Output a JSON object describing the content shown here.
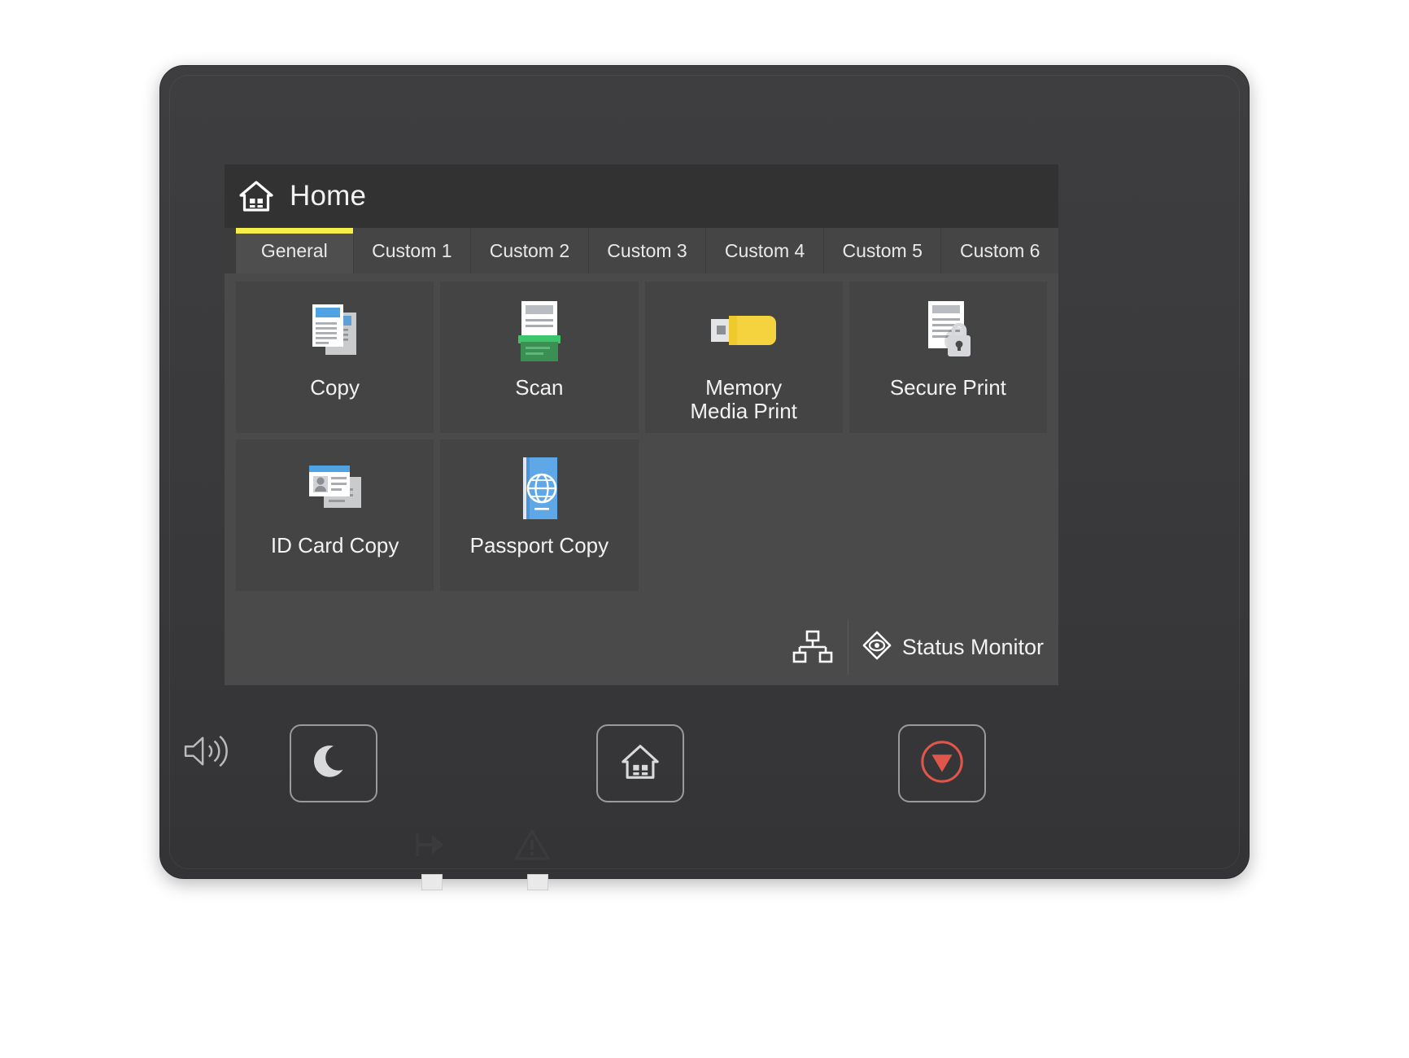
{
  "screen": {
    "header": {
      "title": "Home",
      "icon": "home-house-icon"
    },
    "tabs": [
      {
        "label": "General",
        "active": true
      },
      {
        "label": "Custom 1",
        "active": false
      },
      {
        "label": "Custom 2",
        "active": false
      },
      {
        "label": "Custom 3",
        "active": false
      },
      {
        "label": "Custom 4",
        "active": false
      },
      {
        "label": "Custom 5",
        "active": false
      },
      {
        "label": "Custom 6",
        "active": false
      }
    ],
    "tiles": [
      {
        "label": "Copy",
        "icon": "copy-documents-icon"
      },
      {
        "label": "Scan",
        "icon": "scan-tray-icon"
      },
      {
        "label": "Memory\nMedia Print",
        "icon": "usb-drive-icon"
      },
      {
        "label": "Secure Print",
        "icon": "document-lock-icon"
      },
      {
        "label": "ID Card Copy",
        "icon": "id-card-icon"
      },
      {
        "label": "Passport Copy",
        "icon": "passport-globe-icon"
      }
    ],
    "status_bar": {
      "network_icon": "network-sitemap-icon",
      "status_monitor_icon": "status-monitor-eye-icon",
      "status_monitor_label": "Status Monitor"
    }
  },
  "hardware": {
    "speaker_icon": "speaker-volume-icon",
    "keys": [
      {
        "name": "sleep",
        "icon": "moon-sleep-icon"
      },
      {
        "name": "home",
        "icon": "home-house-icon"
      },
      {
        "name": "stop",
        "icon": "stop-octagon-icon"
      }
    ],
    "lamps": [
      {
        "name": "data",
        "icon": "data-arrow-icon"
      },
      {
        "name": "error",
        "icon": "warning-triangle-icon"
      }
    ]
  },
  "colors": {
    "accent_yellow": "#f6ef4a",
    "screen_bg": "#3c3c3c",
    "tile_bg": "#444444",
    "tile_area_bg": "#4a4a4a",
    "header_bg": "#323232",
    "tab_bg": "#454545",
    "tab_active_bg": "#4e4e4e",
    "text": "#f2f2f2",
    "stop_red": "#e1564a",
    "scan_green": "#3aa35a",
    "usb_yellow": "#f5d33f",
    "doc_blue": "#4fa3e3"
  }
}
